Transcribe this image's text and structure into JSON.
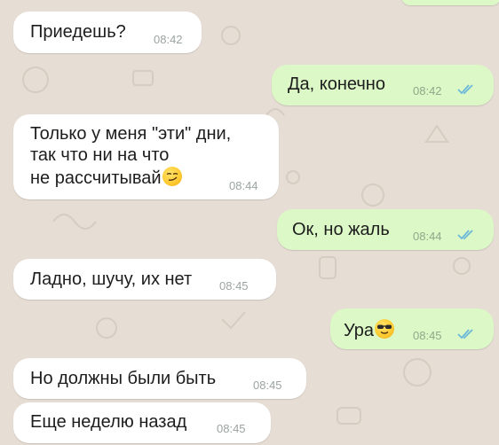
{
  "messages": [
    {
      "id": "m1",
      "direction": "incoming",
      "text": "Приедешь?",
      "time": "08:42"
    },
    {
      "id": "m2",
      "direction": "outgoing",
      "text": "Да, конечно",
      "time": "08:42",
      "status": "read"
    },
    {
      "id": "m3",
      "direction": "incoming",
      "lines": [
        "Только у меня \"эти\" дни,",
        "так что ни на что",
        "не рассчитывай"
      ],
      "emoji": "smirking-face",
      "time": "08:44"
    },
    {
      "id": "m4",
      "direction": "outgoing",
      "text": "Ок, но жаль",
      "time": "08:44",
      "status": "read"
    },
    {
      "id": "m5",
      "direction": "incoming",
      "text": "Ладно, шучу, их нет",
      "time": "08:45"
    },
    {
      "id": "m6",
      "direction": "outgoing",
      "text": "Ура",
      "emoji": "sunglasses-face",
      "time": "08:45",
      "status": "read"
    },
    {
      "id": "m7",
      "direction": "incoming",
      "text": "Но должны были быть",
      "time": "08:45"
    },
    {
      "id": "m8",
      "direction": "incoming",
      "text": "Еще неделю назад",
      "time": "08:45"
    }
  ],
  "colors": {
    "wallpaper": "#e6ddd4",
    "incoming_bubble": "#ffffff",
    "outgoing_bubble": "#dcf8c6",
    "read_ticks": "#6bb8d9"
  }
}
